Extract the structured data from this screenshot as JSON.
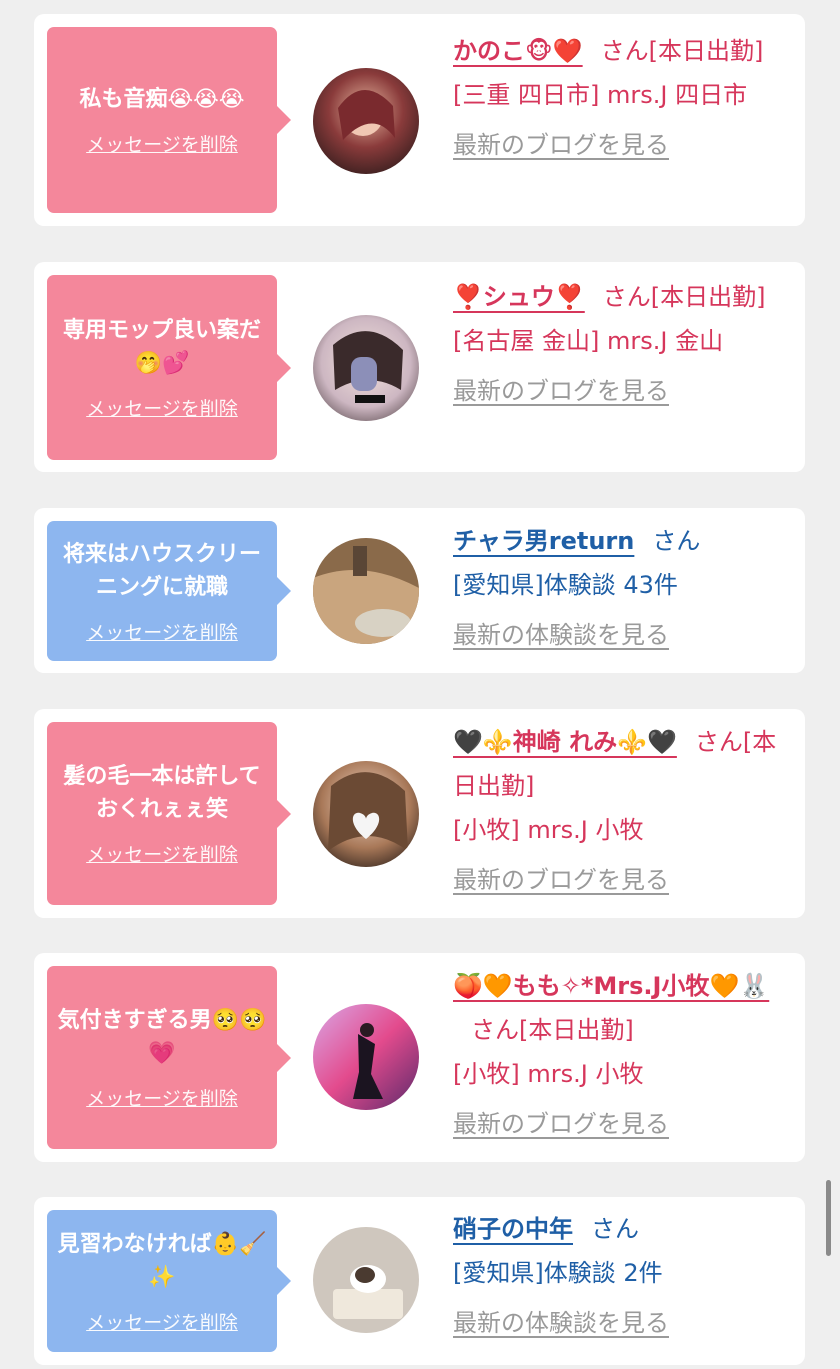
{
  "delete_label": "メッセージを削除",
  "san_label": "さん",
  "cards": [
    {
      "bubble_text": "私も音痴😭😭😭",
      "name": "かのこ🐵❤️",
      "after_name": "さん[本日出勤]",
      "location": "[三重 四日市] mrs.J 四日市",
      "link": "最新のブログを見る"
    },
    {
      "bubble_text": "専用モップ良い案だ🤭💕",
      "name": "❣️シュウ❣️",
      "after_name": "さん[本日出勤]",
      "location": "[名古屋 金山] mrs.J 金山",
      "link": "最新のブログを見る"
    },
    {
      "bubble_text": "将来はハウスクリーニングに就職",
      "name": "チャラ男return",
      "after_name": "さん",
      "location": "[愛知県]体験談 43件",
      "link": "最新の体験談を見る"
    },
    {
      "bubble_text": "髪の毛一本は許しておくれぇぇ笑",
      "name": "🖤⚜️神崎 れみ⚜️🖤",
      "after_name": "さん[本日出勤]",
      "location": "[小牧] mrs.J 小牧",
      "link": "最新のブログを見る"
    },
    {
      "bubble_text": "気付きすぎる男🥺🥺💗",
      "name": "🍑🧡もも✧*Mrs.J小牧🧡🐰",
      "after_name": "さん[本日出勤]",
      "location": "[小牧] mrs.J 小牧",
      "link": "最新のブログを見る"
    },
    {
      "bubble_text": "見習わなければ👶🧹✨",
      "name": "硝子の中年",
      "after_name": "さん",
      "location": "[愛知県]体験談 2件",
      "link": "最新の体験談を見る"
    }
  ],
  "colors": {
    "pink_bubble": "#f4879b",
    "blue_bubble": "#8db6ef",
    "pink_text": "#d6365b",
    "blue_text": "#1f5fa6",
    "link_gray": "#9a9a9a"
  }
}
